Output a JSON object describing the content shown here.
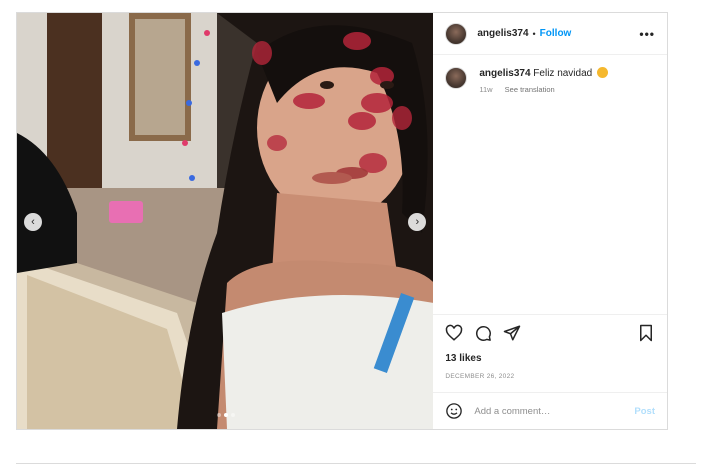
{
  "post": {
    "username": "angelis374",
    "separator": "•",
    "follow_label": "Follow",
    "more_label": "•••",
    "caption_username": "angelis374",
    "caption_text": "Feliz navidad",
    "caption_emoji": "smiling-face-with-heart-eyes-emoji",
    "time_ago": "11w",
    "see_translation": "See translation",
    "likes": "13 likes",
    "date": "DECEMBER 26, 2022",
    "comment_placeholder": "Add a comment…",
    "post_label": "Post"
  },
  "media": {
    "prev_label": "‹",
    "next_label": "›",
    "carousel_count": 3,
    "carousel_active_index": 1
  },
  "icons": {
    "like": "heart-icon",
    "comment": "comment-bubble-icon",
    "share": "paper-plane-icon",
    "save": "bookmark-icon",
    "emoji": "smiley-icon",
    "more": "more-options-icon"
  },
  "colors": {
    "follow": "#0095f6",
    "post_disabled": "#b2dffc",
    "border": "#dbdbdb",
    "muted": "#8e8e8e"
  }
}
